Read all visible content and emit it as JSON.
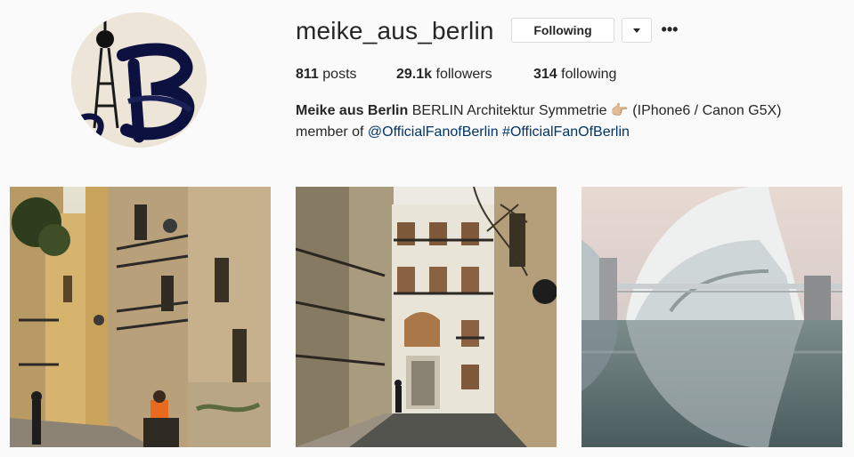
{
  "profile": {
    "username": "meike_aus_berlin",
    "following_label": "Following",
    "more_label": "•••"
  },
  "stats": {
    "posts_count": "811",
    "posts_label": "posts",
    "followers_count": "29.1k",
    "followers_label": "followers",
    "following_count": "314",
    "following_label": "following"
  },
  "bio": {
    "name": "Meike aus Berlin",
    "text": "BERLIN Architektur Symmetrie",
    "emoji": "👉🏼",
    "devices": "(IPhone6 / Canon G5X)",
    "member_prefix": "member of",
    "mention": "@OfficialFanofBerlin",
    "hashtag": "#OfficialFanOfBerlin"
  },
  "posts": [
    {
      "subject": "narrow street with yellow buildings and balconies"
    },
    {
      "subject": "street with white building and wooden door"
    },
    {
      "subject": "futuristic white building reflected in water"
    }
  ],
  "colors": {
    "background": "#fafafa",
    "text": "#262626",
    "link": "#003569",
    "border": "#dbdbdb"
  }
}
